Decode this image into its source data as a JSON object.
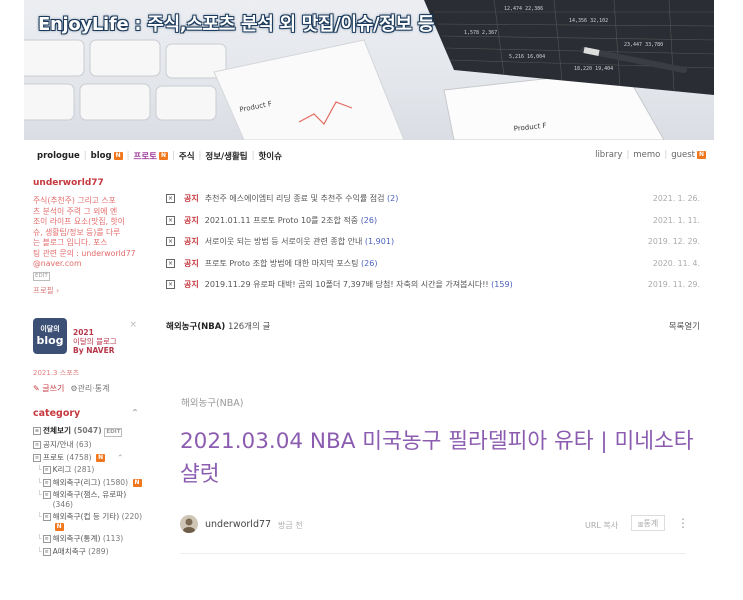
{
  "banner": {
    "title": "EnjoyLife : 주식,스포츠 분석 외 맛집/이슈/정보 등",
    "product_label_1": "Product F",
    "product_label_2": "Product F"
  },
  "topmenu": {
    "left": [
      {
        "label": "prologue",
        "badge": ""
      },
      {
        "label": "blog",
        "badge": "N"
      },
      {
        "label": "프로토",
        "badge": "N",
        "active": true
      },
      {
        "label": "주식",
        "badge": ""
      },
      {
        "label": "정보/생활팁",
        "badge": ""
      },
      {
        "label": "핫이슈",
        "badge": ""
      }
    ],
    "right": [
      {
        "label": "library",
        "badge": ""
      },
      {
        "label": "memo",
        "badge": ""
      },
      {
        "label": "guest",
        "badge": "N"
      }
    ]
  },
  "sidebar": {
    "owner": "underworld77",
    "desc_lines": [
      "주식(추천주) 그리고 스포",
      "츠 분석이 주력 그 외에 엔",
      "조이 라이프 요소(맛집, 핫이",
      "슈, 생활팁/정보 등)를 다루",
      "는 블로그 입니다.    포스",
      "팅 관련 문의 : underworld77",
      "@naver.com"
    ],
    "edit_badge": "EDIT",
    "profile_link": "프로필 ›",
    "award": {
      "badge_top": "이달의",
      "badge_main": "blog",
      "line1": "2021",
      "line2": "이달의 블로그",
      "line3": "By NAVER",
      "close": "×"
    },
    "award_meta": "2021.3  스포츠",
    "write": "글쓰기",
    "admin": "관리·통계",
    "category_title": "category",
    "category_caret": "⌃",
    "categories": [
      {
        "label": "전체보기",
        "count": "(5047)",
        "badge": "EDIT",
        "level": 1,
        "bold": true
      },
      {
        "label": "공지/안내",
        "count": "(63)",
        "badge": "",
        "level": 1
      },
      {
        "label": "프로토",
        "count": "(4758)",
        "badge": "N",
        "level": 1,
        "caret": "⌃"
      },
      {
        "label": "K리그",
        "count": "(281)",
        "badge": "",
        "level": 2
      },
      {
        "label": "해외축구(리그)",
        "count": "(1580)",
        "badge": "N",
        "level": 2
      },
      {
        "label": "해외축구(챔스, 유로파)",
        "count": "(346)",
        "badge": "",
        "level": 2
      },
      {
        "label": "해외축구(컵 등 기타)",
        "count": "(220)",
        "badge": "N",
        "level": 2
      },
      {
        "label": "해외축구(통계)",
        "count": "(113)",
        "badge": "",
        "level": 2
      },
      {
        "label": "A매치축구",
        "count": "(289)",
        "badge": "",
        "level": 2
      }
    ]
  },
  "notices": [
    {
      "tag": "공지",
      "title": "추천주 에스에이엠티 리딩 종료 및 추천주 수익률 점검",
      "count": "(2)",
      "date": "2021. 1. 26."
    },
    {
      "tag": "공지",
      "title": "2021.01.11 프로토 Proto 10를 2조합 적중",
      "count": "(26)",
      "date": "2021. 1. 11."
    },
    {
      "tag": "공지",
      "title": "서로이웃 되는 방법 등 서로이웃 관련 종합 안내",
      "count": "(1,901)",
      "date": "2019. 12. 29."
    },
    {
      "tag": "공지",
      "title": "프로토 Proto 조합 방법에 대한 마지막 포스팅",
      "count": "(26)",
      "date": "2020. 11. 4."
    },
    {
      "tag": "공지",
      "title": "2019.11.29 유로파 대박! 곰의 10폴더 7,397배 당첨! 자축의 시간을 가져봅시다!!",
      "count": "(159)",
      "date": "2019. 11. 29."
    }
  ],
  "listhead": {
    "category": "해외농구(NBA)",
    "count": "126개의 글",
    "open": "목록열기"
  },
  "post": {
    "category": "해외농구(NBA)",
    "title": "2021.03.04 NBA 미국농구 필라델피아 유타 | 미네소타 샬럿",
    "author": "underworld77",
    "when": "방금 전",
    "url_copy": "URL 복사",
    "stats": "통계",
    "more": "⋮"
  },
  "colors": {
    "accent": "#c5393f",
    "title": "#8b5cb0",
    "badge": "#f0771e"
  }
}
